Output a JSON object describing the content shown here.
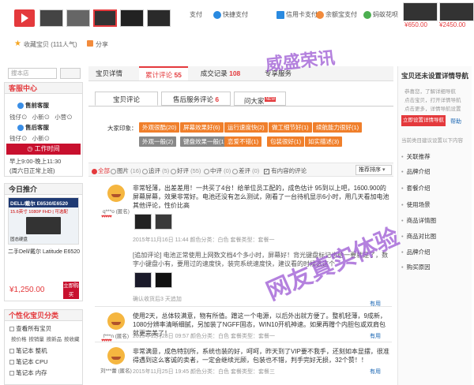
{
  "gallery": {
    "thumbs": 5
  },
  "collect": {
    "label": "收藏宝贝 (111人气)"
  },
  "share": {
    "label": "分享"
  },
  "payment": {
    "prefix": "支付",
    "quick": "快捷支付",
    "credit": "信用卡支付",
    "balance": "余额宝支付",
    "huabei": "蚂蚁花呗"
  },
  "recommend": {
    "prices": [
      "¥650.00",
      "¥2450.00"
    ]
  },
  "sidebar": {
    "search_placeholder": "搜本店",
    "service_title": "客服中心",
    "presale": "售前客服",
    "presale_agents": [
      "钱仔",
      "小新",
      "小营"
    ],
    "aftersale": "售后客服",
    "aftersale_agents": [
      "钱仔",
      "小新"
    ],
    "work_time_label": "工作时间",
    "work_time": "早上9:00-晚上11:30",
    "weekday": "(周六日正常上班)",
    "today_title": "今日推介",
    "today_img_title": "DELL/戴尔 E6530/E6520",
    "today_img_sub": "15.6英寸 1080P FHD | 可选配",
    "today_img_foot": "固态硬盘",
    "today_name": "二手Dell/戴尔 Latitude E6520",
    "today_price": "¥1,250.00",
    "today_buy": "立即购买",
    "cat_title": "个性化宝贝分类",
    "cats": [
      "查看所有宝贝",
      "笔记本 整机",
      "笔记本 CPU",
      "笔记本 内存"
    ],
    "cat_sub": [
      "按价格",
      "按销量",
      "按新品",
      "按收藏"
    ]
  },
  "tabs": [
    {
      "label": "宝贝详情"
    },
    {
      "label": "累计评论",
      "count": "55"
    },
    {
      "label": "成交记录",
      "count": "108"
    },
    {
      "label": "专享服务"
    }
  ],
  "subtabs": [
    {
      "label": "宝贝评论"
    },
    {
      "label": "售后服务评论",
      "count": "6"
    },
    {
      "label": "问大家",
      "badge": "NEW"
    }
  ],
  "impression": {
    "label": "大家印象：",
    "tags": [
      "外观很酷(20)",
      "屏幕效果好(6)",
      "运行速度快(2)",
      "做工细节好(1)",
      "续航能力很好(1)",
      "外观一般(2)",
      "键盘效果一般(1)",
      "恋爱不错(1)",
      "包装很好(1)",
      "如实描述(3)"
    ]
  },
  "filters": {
    "all": "全部",
    "pic": "图片",
    "pic_n": "(16)",
    "add": "追评",
    "add_n": "(5)",
    "good": "好评",
    "good_n": "(55)",
    "mid": "中评",
    "mid_n": "(0)",
    "bad": "差评",
    "bad_n": "(0)",
    "content": "有内容的评论",
    "sort": "推荐排序"
  },
  "reviews": [
    {
      "user": "q***o (匿名)",
      "text": "非常轻薄，出差差用！一共买了4台！给单位员工配的，成色估计 95到以上吧，1600.900的屏幕屏幕，效果非常好。电池还没有怎么测试，刚看了一台待机显示6小时，用几天看加电池其他评论，性价比高",
      "meta": "2015年11月16日 11:44    颜色分类：白色  套餐类型：套餐一",
      "append": "[追加评论] 电池正常使用上网数文档4个多小时，屏幕好！背光键盘标记也给一要就是了，数字小键盘小有，要用过的速度快，装完系统速度快，建议看的时候选这个",
      "append_meta": "确认收货后3 天追加",
      "useful": "有用"
    },
    {
      "user": "f***n (匿名)",
      "text": "使用2天，总体较满意，物有所值。蹭这一个电源，以后外出就方便了。整机轻薄，9成新，1080分辨率清晰细腻，另加装了NGFF固态，WIN10开机神速。如果再赠个内胆包或双肩包就更完美了！",
      "meta": "2015年11月28日 09:57    颜色分类：白色  套餐类型：套餐一",
      "useful": "有用"
    },
    {
      "user": "刘***蕾 (匿名)",
      "text": "非常满意，成色特别所，系统也装的好，呵呵，昨天到了VIP要不我手，还刻如本显摆，很准得遇到这么客诚的卖者，一定会继续光顾，包装也不错，判手完好无损，32个赞！！",
      "meta": "2015年11月25日 19:45    颜色分类：白色  套餐类型：套餐三",
      "useful": "有用"
    }
  ],
  "rightnav": {
    "title": "宝贝还未设置详情导航",
    "steps": [
      "恭喜您，了解详细导航",
      "点击宝贝，打开详情导航",
      "点击更多，详情导航设置"
    ],
    "btn": "立即设置详情导航",
    "help": "帮助",
    "current": "当前类目建议设置以下内容",
    "items": [
      "关联推荐",
      "品牌介绍",
      "套餐介绍",
      "使用场景",
      "商品详情图",
      "商品对比图",
      "品牌介绍",
      "购买原因"
    ]
  },
  "watermarks": {
    "top": "威盛荣讯",
    "mid": "网友真实体验"
  }
}
